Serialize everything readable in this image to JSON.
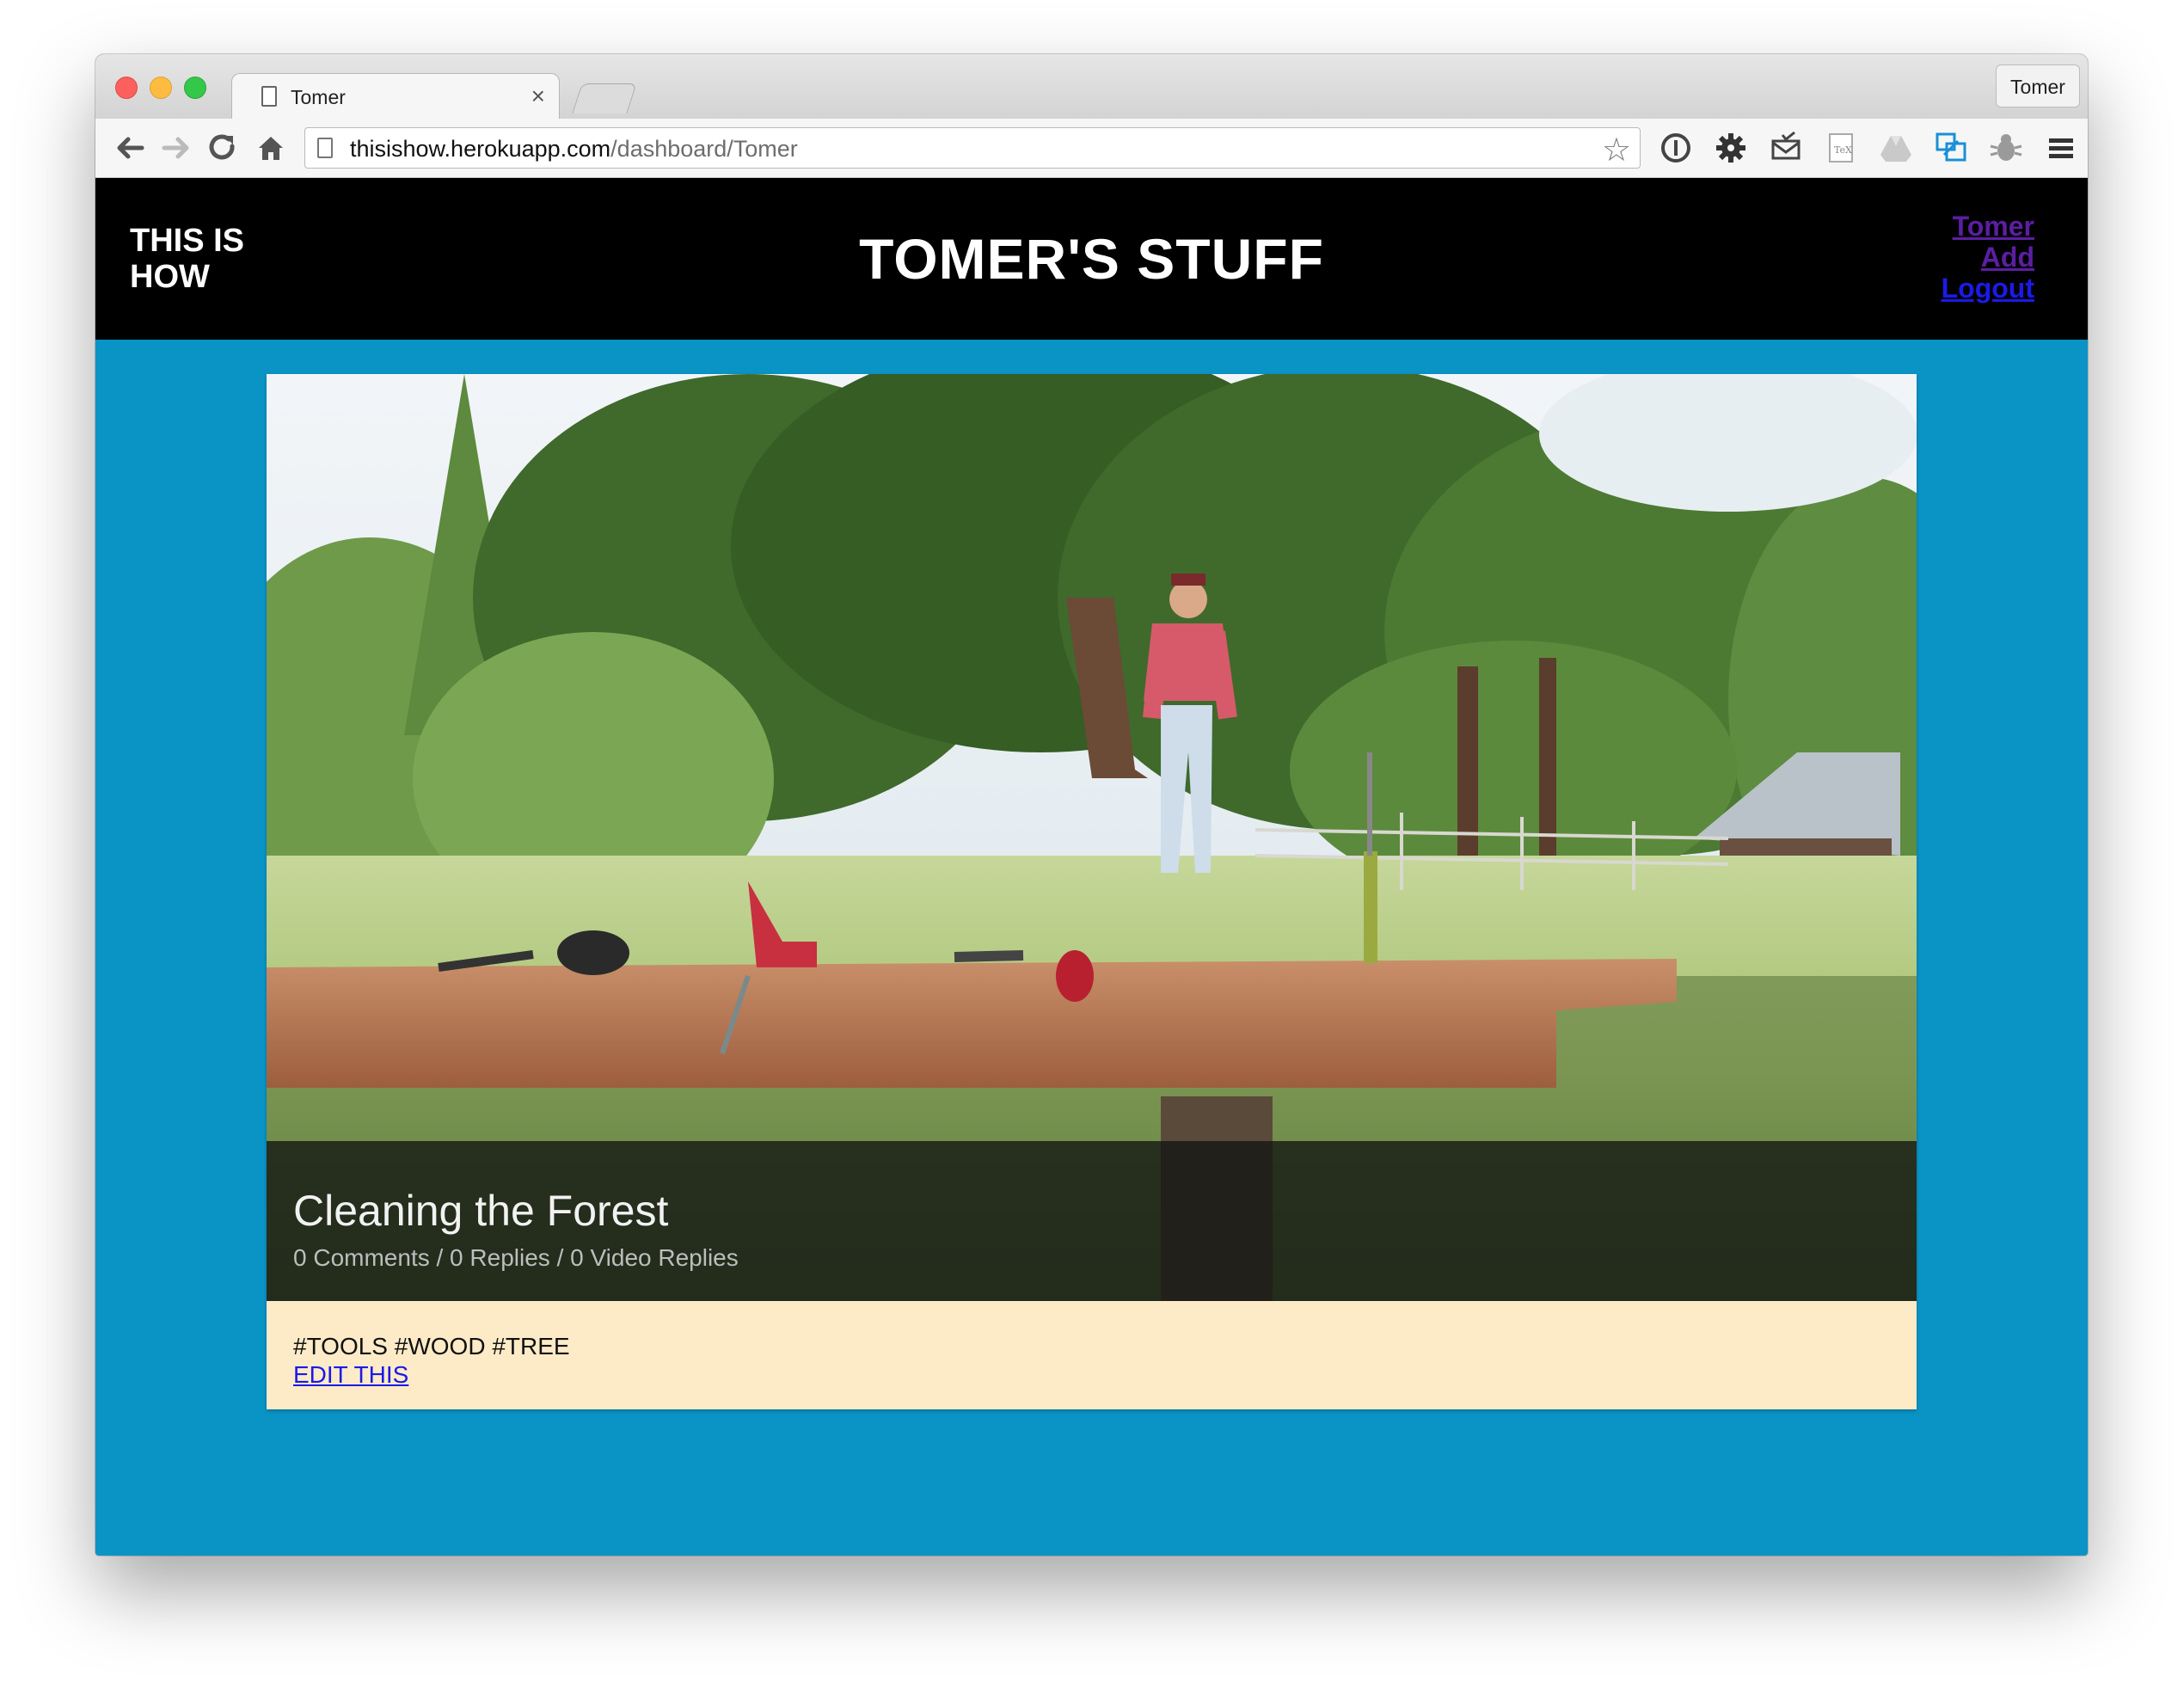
{
  "browser": {
    "tab_title": "Tomer",
    "tab_close": "×",
    "profile_name": "Tomer",
    "url_host": "thisishow.herokuapp.com",
    "url_path": "/dashboard/Tomer",
    "icons": [
      "back-arrow-icon",
      "forward-arrow-icon",
      "reload-icon",
      "home-icon",
      "page-icon",
      "star-icon",
      "onepassword-icon",
      "gear-icon",
      "mail-icon",
      "tex-icon",
      "drive-icon",
      "screen-capture-icon",
      "bug-icon",
      "menu-icon"
    ]
  },
  "header": {
    "logo": "THIS IS\nHOW",
    "title": "TOMER'S STUFF",
    "nav": [
      "Tomer",
      "Add",
      "Logout"
    ]
  },
  "post": {
    "title": "Cleaning the Forest",
    "meta": "0 Comments / 0 Replies / 0 Video Replies",
    "tags": "#TOOLS #WOOD #TREE",
    "edit_label": "EDIT THIS"
  },
  "colors": {
    "page_background": "#0a94c6",
    "header_background": "#000000",
    "card_footer": "#fdebc8",
    "visited_link": "#5b1ea3",
    "link": "#1a1ae8"
  }
}
